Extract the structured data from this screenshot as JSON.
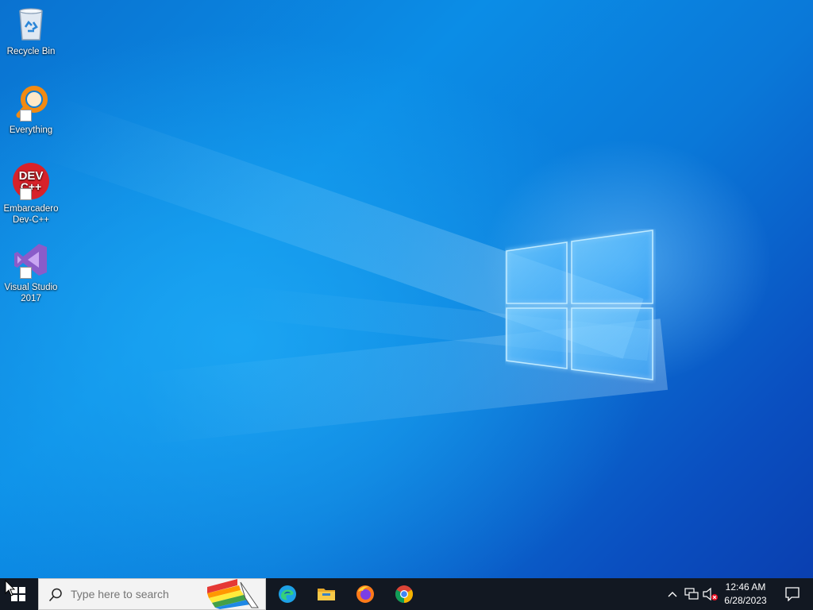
{
  "desktop": {
    "icons": [
      {
        "label": "Recycle Bin",
        "icon": "recycle-bin-icon"
      },
      {
        "label": "Everything",
        "icon": "everything-search-icon"
      },
      {
        "label": "Embarcadero Dev-C++",
        "icon": "dev-cpp-icon",
        "badge_text": "DEV C++"
      },
      {
        "label": "Visual Studio 2017",
        "icon": "visual-studio-icon"
      }
    ]
  },
  "taskbar": {
    "search_placeholder": "Type here to search",
    "pinned_apps": [
      {
        "name": "Microsoft Edge",
        "icon": "edge-icon"
      },
      {
        "name": "File Explorer",
        "icon": "folder-icon"
      },
      {
        "name": "Firefox",
        "icon": "firefox-icon"
      },
      {
        "name": "Google Chrome",
        "icon": "chrome-icon"
      }
    ],
    "tray": {
      "time": "12:46 AM",
      "date": "6/28/2023"
    }
  },
  "colors": {
    "taskbar_bg": "#121822",
    "desktop_accent": "#0b8de6",
    "logo_glow": "#9fd8ff"
  }
}
